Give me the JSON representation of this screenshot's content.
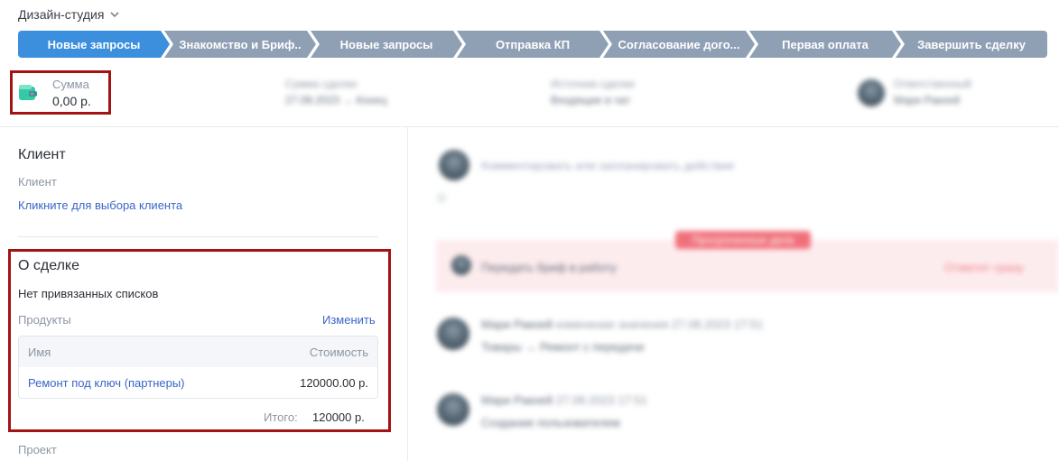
{
  "header": {
    "workspace": "Дизайн-студия"
  },
  "pipeline": {
    "stages": [
      {
        "label": "Новые запросы",
        "active": true
      },
      {
        "label": "Знакомство и Бриф..",
        "active": false
      },
      {
        "label": "Новые запросы",
        "active": false
      },
      {
        "label": "Отправка КП",
        "active": false
      },
      {
        "label": "Согласование дого...",
        "active": false
      },
      {
        "label": "Первая оплата",
        "active": false
      },
      {
        "label": "Завершить сделку",
        "active": false
      }
    ],
    "colors": {
      "active": "#3b8fdc",
      "inactive": "#8fa0b5"
    }
  },
  "summary": {
    "amount_label": "Сумма",
    "amount_value": "0,00 р.",
    "blurred": {
      "deal_date_label": "Сумма сделки",
      "deal_date_value": "27.08.2023 → Конец",
      "source_label": "Источник сделки",
      "source_value": "Входящие в чат",
      "owner_label": "Ответственный",
      "owner_value": "Мари Ракней"
    }
  },
  "client": {
    "title": "Клиент",
    "field_label": "Клиент",
    "select_link": "Кликните для выбора клиента"
  },
  "deal": {
    "title": "О сделке",
    "no_lists": "Нет привязанных списков",
    "products_label": "Продукты",
    "edit_link": "Изменить",
    "table": {
      "col_name": "Имя",
      "col_cost": "Стоимость",
      "rows": [
        {
          "name": "Ремонт под ключ (партнеры)",
          "cost": "120000.00 р."
        }
      ]
    },
    "total_label": "Итого:",
    "total_value": "120000 р."
  },
  "project": {
    "label": "Проект"
  },
  "feed": {
    "comment_placeholder": "Комментировать или запланировать действие",
    "filter_hint": "▾",
    "overdue_badge": "Просроченные дела",
    "task_text": "Передать бриф в работу",
    "task_action": "Отметит сразу",
    "entry1_author": "Мари Ракней",
    "entry1_meta": "изменение значения 27.08.2023 17:51",
    "entry1_text": "Товары → Ремонт с передачи",
    "entry2_author": "Мари Ракней",
    "entry2_meta": "27.08.2023 17:51",
    "entry2_text": "Создание пользователем"
  },
  "highlight_color": "#a31313"
}
